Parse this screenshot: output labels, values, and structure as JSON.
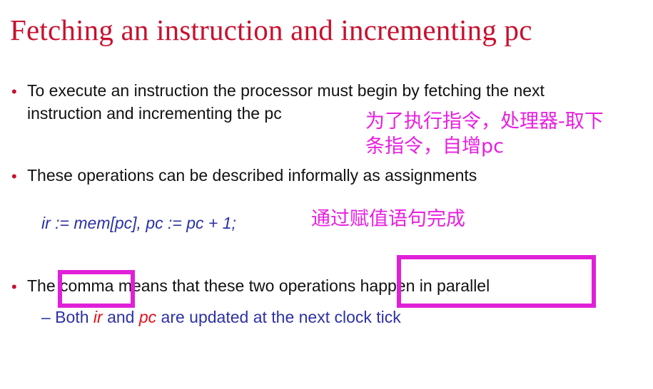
{
  "slide": {
    "title": "Fetching an instruction and incrementing pc",
    "bullet_marker": "•",
    "bullets": [
      {
        "line1": "To execute an instruction the processor must begin by fetching the next",
        "line2": "instruction and incrementing the pc"
      },
      {
        "line1": "These operations can be described informally as assignments"
      },
      {
        "line1": "The comma means that these two operations happen in parallel"
      }
    ],
    "code": "ir := mem[pc], pc := pc + 1;",
    "sub_bullet": {
      "dash": "–",
      "part1": " Both ",
      "ir": "ir",
      "part2": " and ",
      "pc": "pc",
      "part3": " are updated at the next clock tick"
    }
  },
  "annotations": {
    "note1_line1": "为了执行指令，处理器-取下",
    "note1_line2": "条指令，自增pc",
    "note2": "通过赋值语句完成",
    "color": "#e81fe0"
  },
  "colors": {
    "title": "#c8102e",
    "code": "#2d31a6",
    "emphasis": "#e0101c",
    "highlight_box": "#e020d8"
  }
}
